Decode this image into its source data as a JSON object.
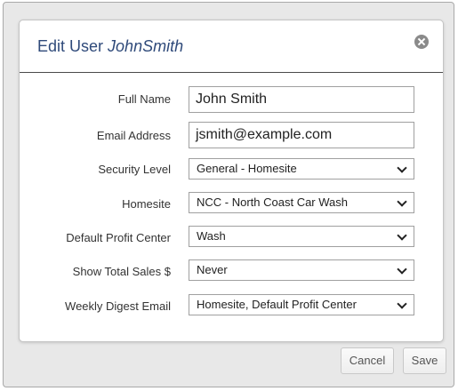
{
  "dialog": {
    "title_prefix": "Edit User",
    "title_user": "JohnSmith",
    "close_icon": "close-icon"
  },
  "form": {
    "full_name": {
      "label": "Full Name",
      "value": "John Smith"
    },
    "email": {
      "label": "Email Address",
      "value": "jsmith@example.com"
    },
    "security_level": {
      "label": "Security Level",
      "value": "General - Homesite"
    },
    "homesite": {
      "label": "Homesite",
      "value": "NCC - North Coast Car Wash"
    },
    "default_profit_center": {
      "label": "Default Profit Center",
      "value": "Wash"
    },
    "show_total_sales": {
      "label": "Show Total Sales $",
      "value": "Never"
    },
    "weekly_digest_email": {
      "label": "Weekly Digest Email",
      "value": "Homesite, Default Profit Center"
    }
  },
  "buttons": {
    "cancel": "Cancel",
    "save": "Save"
  },
  "colors": {
    "title": "#2f4a7a",
    "background": "#e8e8e8"
  }
}
